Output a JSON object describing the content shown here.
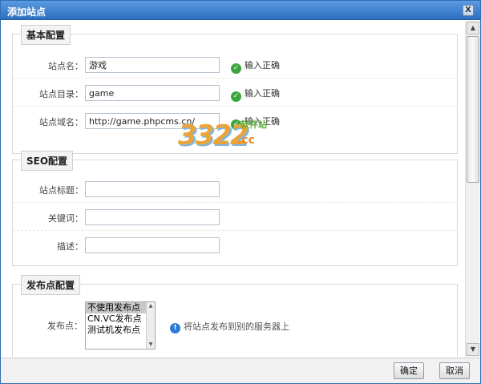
{
  "dialog": {
    "title": "添加站点",
    "close_label": "X"
  },
  "basic": {
    "legend": "基本配置",
    "rows": [
      {
        "label": "站点名：",
        "value": "游戏",
        "status": "输入正确"
      },
      {
        "label": "站点目录：",
        "value": "game",
        "status": "输入正确"
      },
      {
        "label": "站点域名：",
        "value": "http://game.phpcms.cn/",
        "status": "输入正确"
      }
    ]
  },
  "seo": {
    "legend": "SEO配置",
    "rows": [
      {
        "label": "站点标题：",
        "value": ""
      },
      {
        "label": "关键词：",
        "value": ""
      },
      {
        "label": "描述：",
        "value": ""
      }
    ]
  },
  "publish": {
    "legend": "发布点配置",
    "label": "发布点：",
    "options": [
      "不使用发布点",
      "CN.VC发布点",
      "测试机发布点"
    ],
    "selected_index": 0,
    "hint": "将站点发布到别的服务器上"
  },
  "watermark": {
    "number": "3322",
    "domain": ".cc",
    "text": "软件站"
  },
  "footer": {
    "confirm": "确定",
    "cancel": "取消"
  }
}
